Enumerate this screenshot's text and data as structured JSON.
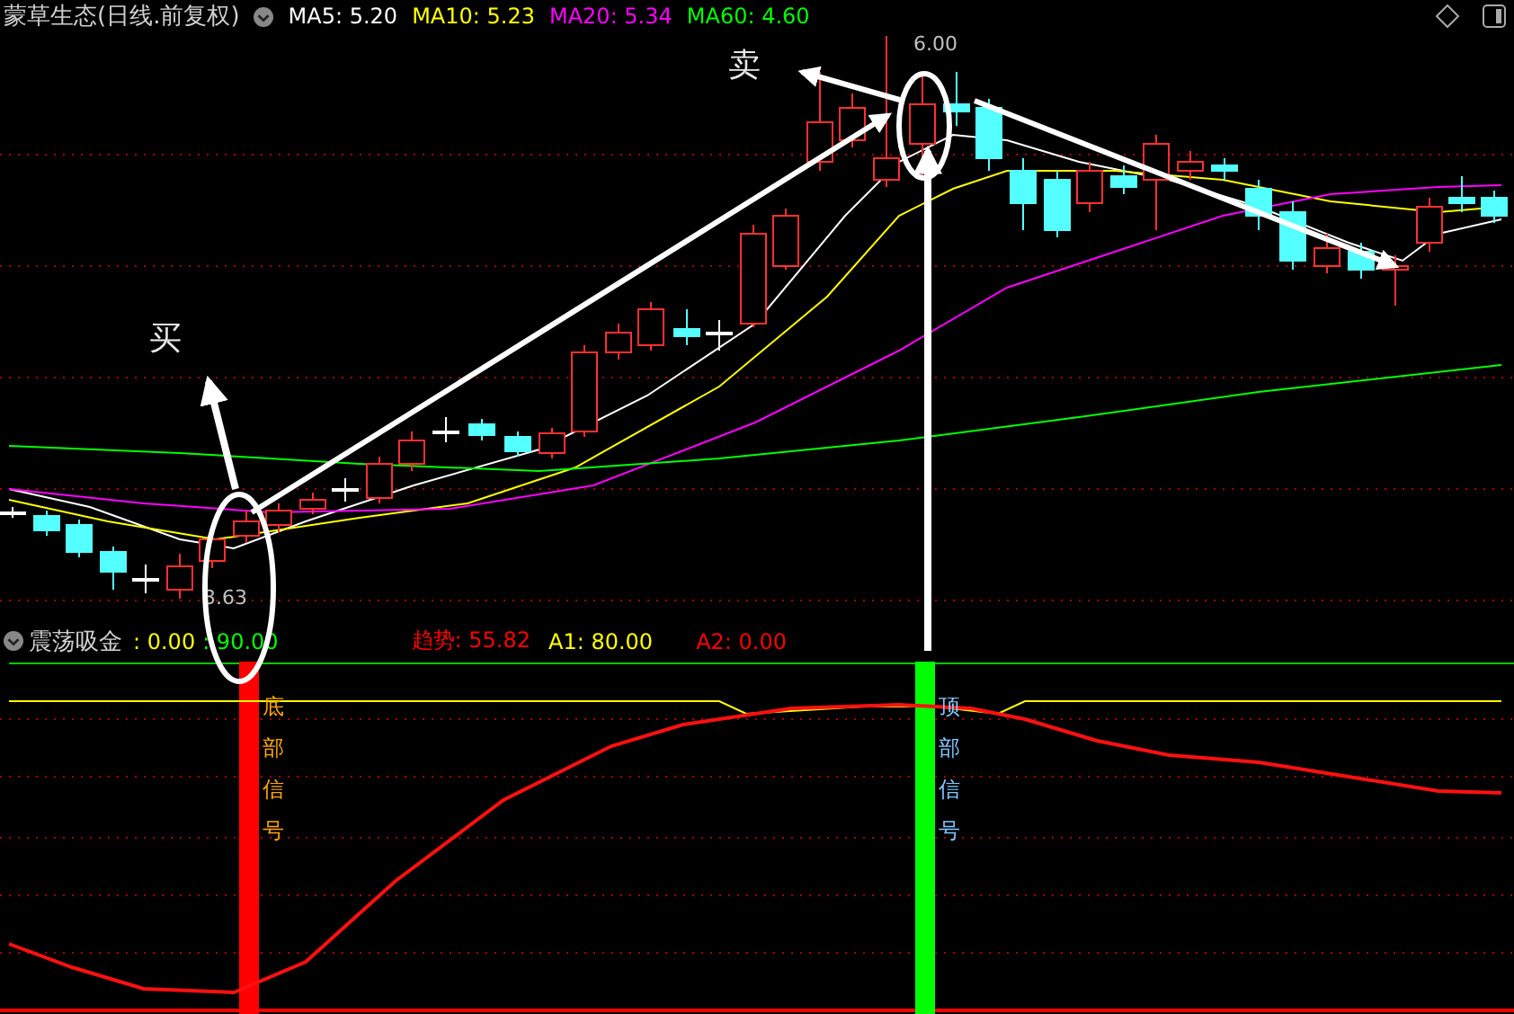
{
  "header": {
    "title": "蒙草生态(日线.前复权)",
    "indicators": [
      {
        "label": "MA5: 5.20",
        "color": "#ffffff"
      },
      {
        "label": "MA10: 5.23",
        "color": "#ffff00"
      },
      {
        "label": "MA20: 5.34",
        "color": "#ff00ff"
      },
      {
        "label": "MA60: 4.60",
        "color": "#00ff00"
      }
    ]
  },
  "main_chart": {
    "high_label": "6.00",
    "low_label": "3.63",
    "annotations": [
      {
        "text": "买"
      },
      {
        "text": "卖"
      }
    ]
  },
  "lower_panel": {
    "name": "震荡吸金",
    "values": [
      {
        "text": ": 0.00",
        "color": "#ffff00"
      },
      {
        "text": ": 90.00",
        "color": "#00ff00"
      },
      {
        "text": "趋势: 55.82",
        "color": "#ff0000"
      },
      {
        "text": "A1: 80.00",
        "color": "#ffff00"
      },
      {
        "text": "A2: 0.00",
        "color": "#ff0000"
      }
    ],
    "signals": [
      {
        "text": "底部信号",
        "kind": "bottom",
        "color": "#ff0000"
      },
      {
        "text": "顶部信号",
        "kind": "top",
        "color": "#00ff00"
      }
    ]
  }
}
